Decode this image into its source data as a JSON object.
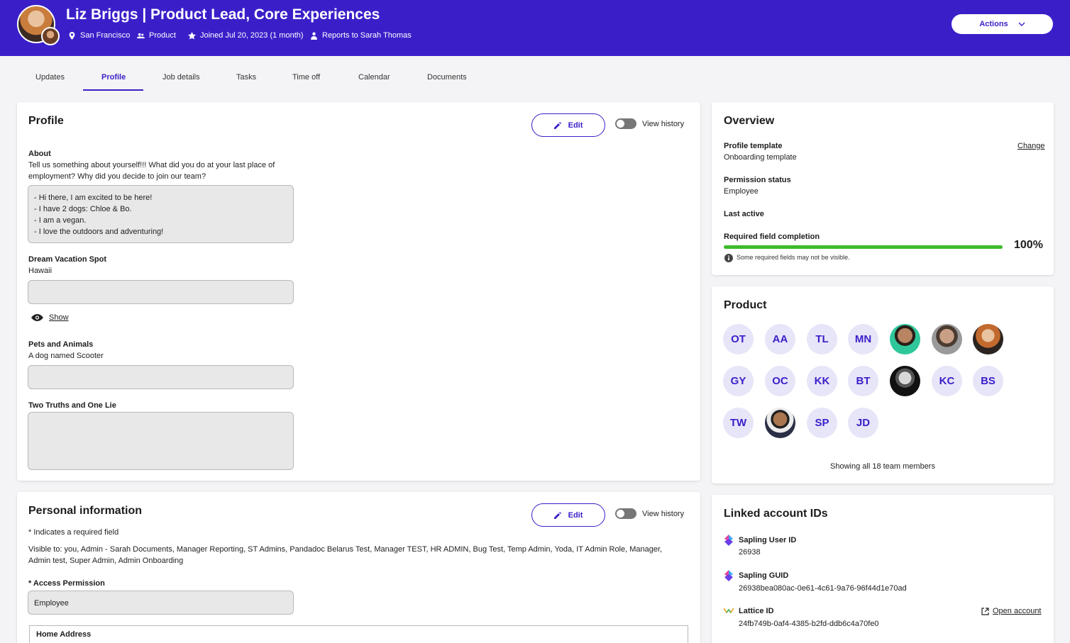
{
  "header": {
    "title": "Liz Briggs | Product Lead, Core Experiences",
    "location": "San Francisco",
    "team": "Product",
    "joined": "Joined Jul 20, 2023 (1 month)",
    "reports_to": "Reports to Sarah Thomas",
    "actions_label": "Actions",
    "bg_color": "#3a1fc9"
  },
  "tabs": [
    "Updates",
    "Profile",
    "Job details",
    "Tasks",
    "Time off",
    "Calendar",
    "Documents"
  ],
  "active_tab": "Profile",
  "profile": {
    "title": "Profile",
    "edit_label": "Edit",
    "view_history": "View history",
    "about_label": "About",
    "about_prompt": "Tell us something about yourself!!! What did you do at your last place of employment? Why did you decide to join our team?",
    "about_lines": [
      "- Hi there, I am excited to be here!",
      "- I have 2 dogs: Chloe & Bo.",
      "- I am a vegan.",
      "- I love the outdoors and adventuring!"
    ],
    "dream_label": "Dream Vacation Spot",
    "dream_value": "Hawaii",
    "show_label": "Show",
    "pets_label": "Pets and Animals",
    "pets_value": "A dog named Scooter",
    "truths_label": "Two Truths and One Lie"
  },
  "personal": {
    "title": "Personal information",
    "edit_label": "Edit",
    "view_history": "View history",
    "required_note": "* Indicates a required field",
    "visible_to": "Visible to: you, Admin - Sarah Documents, Manager Reporting, ST Admins, Pandadoc Belarus Test, Manager TEST, HR ADMIN, Bug Test, Temp Admin, Yoda, IT Admin Role, Manager, Admin test, Super Admin, Admin Onboarding",
    "access_label": "* Access Permission",
    "access_value": "Employee",
    "home_address_label": "Home Address"
  },
  "overview": {
    "title": "Overview",
    "template_label": "Profile template",
    "template_value": "Onboarding template",
    "change_label": "Change",
    "permission_label": "Permission status",
    "permission_value": "Employee",
    "last_active_label": "Last active",
    "completion_label": "Required field completion",
    "completion_value": "100%",
    "completion_fraction": 1.0,
    "completion_note": "Some required fields may not be visible.",
    "progress_color": "#3dbb2a"
  },
  "product": {
    "title": "Product",
    "members": [
      {
        "initials": "OT"
      },
      {
        "initials": "AA"
      },
      {
        "initials": "TL"
      },
      {
        "initials": "MN"
      },
      {
        "photo": true
      },
      {
        "photo": true
      },
      {
        "photo": true
      },
      {
        "initials": "GY"
      },
      {
        "initials": "OC"
      },
      {
        "initials": "KK"
      },
      {
        "initials": "BT"
      },
      {
        "photo": true
      },
      {
        "initials": "KC"
      },
      {
        "initials": "BS"
      },
      {
        "initials": "TW"
      },
      {
        "photo": true
      },
      {
        "initials": "SP"
      },
      {
        "initials": "JD"
      }
    ],
    "footer": "Showing all 18 team members"
  },
  "linked": {
    "title": "Linked account IDs",
    "items": [
      {
        "label": "Sapling User ID",
        "value": "26938"
      },
      {
        "label": "Sapling GUID",
        "value": "26938bea080ac-0e61-4c61-9a76-96f44d1e70ad"
      },
      {
        "label": "Lattice ID",
        "value": "24fb749b-0af4-4385-b2fd-ddb6c4a70fe0"
      }
    ],
    "open_account": "Open account"
  }
}
